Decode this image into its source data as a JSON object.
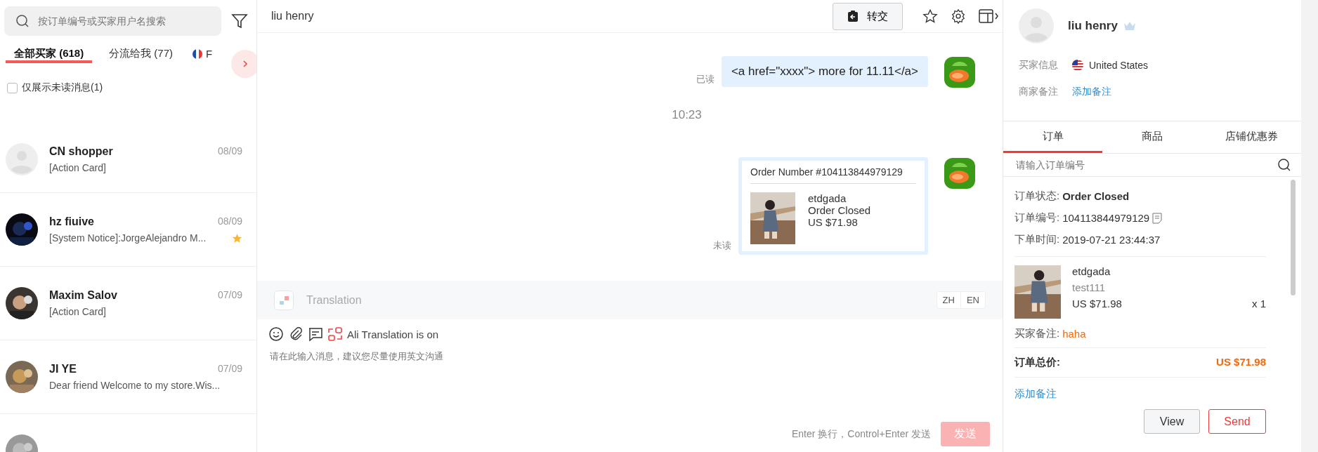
{
  "sidebar": {
    "search": {
      "placeholder": "按订单编号或买家用户名搜索"
    },
    "tabs": [
      {
        "label": "全部买家 (618)",
        "selected": true,
        "kind": "plain"
      },
      {
        "label": "分流给我 (77)",
        "selected": false,
        "kind": "plain"
      },
      {
        "label": "F",
        "selected": false,
        "kind": "flag"
      }
    ],
    "unread_filter": {
      "label": "仅展示未读消息(1)",
      "checked": false
    },
    "conversations": [
      {
        "name": "CN shopper",
        "date": "08/09",
        "preview": "[Action Card]",
        "kind": "silhouette",
        "starred": false
      },
      {
        "name": "hz fiuive",
        "date": "08/09",
        "preview": "[System Notice]:JorgeAlejandro M...",
        "kind": "picture",
        "starred": true
      },
      {
        "name": "Maxim Salov",
        "date": "07/09",
        "preview": "[Action Card]",
        "kind": "picture",
        "starred": false
      },
      {
        "name": "JI YE",
        "date": "07/09",
        "preview": "Dear friend Welcome to my store.Wis...",
        "kind": "picture",
        "starred": false
      },
      {
        "kind": "picture",
        "starred": false
      }
    ]
  },
  "chat": {
    "title": "liu henry",
    "transfer_button": "转交",
    "messages": [
      {
        "kind": "text",
        "status": "已读",
        "text": "<a href=\"xxxx\"> more for 11.11</a>"
      },
      {
        "kind": "time",
        "text": "10:23"
      },
      {
        "kind": "order",
        "status": "未读",
        "order_number": "Order Number #104113844979129",
        "product": "etdgada",
        "state": "Order Closed",
        "price": "US $71.98"
      }
    ],
    "translation": {
      "label": "Translation",
      "languages": [
        "ZH",
        "EN"
      ]
    },
    "toolbar": {
      "translation_status": "Ali Translation is on"
    },
    "input": {
      "placeholder": "请在此输入消息，建议您尽量使用英文沟通"
    },
    "hint": "Enter 换行，Control+Enter 发送",
    "send_button": "发送"
  },
  "buyer": {
    "name": "liu henry",
    "info_label": "买家信息",
    "country": "United States",
    "note_label": "商家备注",
    "add_note": "添加备注",
    "tabs": [
      {
        "label": "订单",
        "selected": true
      },
      {
        "label": "商品",
        "selected": false
      },
      {
        "label": "店铺优惠券",
        "selected": false
      }
    ],
    "order_search": {
      "placeholder": "请输入订单编号"
    },
    "order": {
      "status_label": "订单状态:",
      "status": "Order Closed",
      "number_label": "订单编号:",
      "number": "104113844979129",
      "time_label": "下单时间:",
      "time": "2019-07-21 23:44:37",
      "product": "etdgada",
      "sku": "test111",
      "price": "US $71.98",
      "quantity": "x 1",
      "buyer_note_label": "买家备注:",
      "buyer_note": "haha",
      "total_label": "订单总价:",
      "total": "US $71.98"
    },
    "add_note_link": "添加备注",
    "buttons": [
      "View",
      "Send"
    ]
  }
}
